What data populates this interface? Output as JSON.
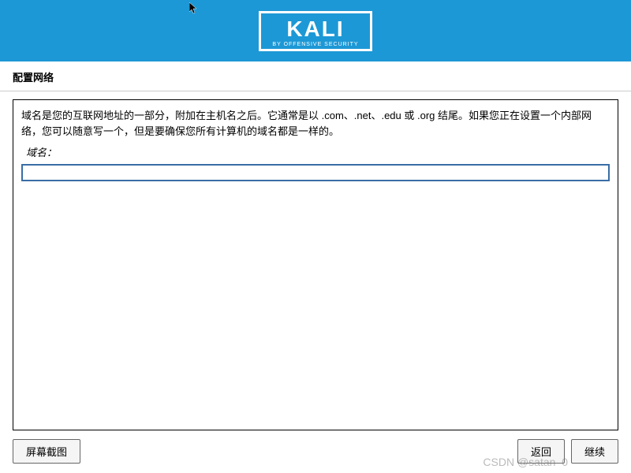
{
  "header": {
    "logo_text": "KALI",
    "logo_subtitle": "BY OFFENSIVE SECURITY"
  },
  "page": {
    "title": "配置网络",
    "description": "域名是您的互联网地址的一部分，附加在主机名之后。它通常是以 .com、.net、.edu 或 .org 结尾。如果您正在设置一个内部网络，您可以随意写一个，但是要确保您所有计算机的域名都是一样的。",
    "field_label": "域名：",
    "field_value": ""
  },
  "buttons": {
    "screenshot": "屏幕截图",
    "back": "返回",
    "continue": "继续"
  },
  "watermark": "CSDN @satan–0"
}
